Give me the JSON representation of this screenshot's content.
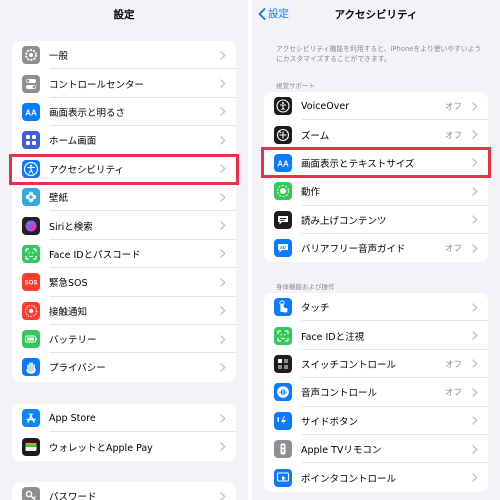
{
  "colors": {
    "highlight": "#e5314a",
    "link": "#0a7aff"
  },
  "left": {
    "title": "設定",
    "group1": [
      {
        "label": "一般",
        "icon": "gear-icon",
        "color": "#8e8e93"
      },
      {
        "label": "コントロールセンター",
        "icon": "toggles-icon",
        "color": "#8e8e93"
      },
      {
        "label": "画面表示と明るさ",
        "icon": "aa-icon",
        "color": "#0a7aff"
      },
      {
        "label": "ホーム画面",
        "icon": "home-grid-icon",
        "color": "#3f5fe0"
      },
      {
        "label": "アクセシビリティ",
        "icon": "accessibility-icon",
        "color": "#0a7aff"
      },
      {
        "label": "壁紙",
        "icon": "flower-icon",
        "color": "#34aadc"
      },
      {
        "label": "Siriと検索",
        "icon": "siri-icon",
        "color": "#222222"
      },
      {
        "label": "Face IDとパスコード",
        "icon": "face-id-icon",
        "color": "#34c759"
      },
      {
        "label": "緊急SOS",
        "icon": "sos-icon",
        "color": "#ff3b30"
      },
      {
        "label": "接触通知",
        "icon": "exposure-icon",
        "color": "#ff3b30"
      },
      {
        "label": "バッテリー",
        "icon": "battery-icon",
        "color": "#34c759"
      },
      {
        "label": "プライバシー",
        "icon": "hand-icon",
        "color": "#0a7aff"
      }
    ],
    "group2": [
      {
        "label": "App Store",
        "icon": "app-store-icon",
        "color": "#0a84ff"
      },
      {
        "label": "ウォレットとApple Pay",
        "icon": "wallet-icon",
        "color": "#1c1c1e"
      }
    ],
    "group3": [
      {
        "label": "パスワード",
        "icon": "key-icon",
        "color": "#8e8e93"
      }
    ]
  },
  "right": {
    "back_label": "設定",
    "title": "アクセシビリティ",
    "description": "アクセシビリティ機能を利用すると、iPhoneをより使いやすいようにカスタマイズすることができます。",
    "vision_header": "視覚サポート",
    "vision": [
      {
        "label": "VoiceOver",
        "value": "オフ",
        "icon": "voiceover-icon",
        "color": "#1c1c1e"
      },
      {
        "label": "ズーム",
        "value": "オフ",
        "icon": "zoom-icon",
        "color": "#1c1c1e"
      },
      {
        "label": "画面表示とテキストサイズ",
        "value": "",
        "icon": "aa-icon",
        "color": "#0a7aff"
      },
      {
        "label": "動作",
        "value": "",
        "icon": "motion-icon",
        "color": "#34c759"
      },
      {
        "label": "読み上げコンテンツ",
        "value": "",
        "icon": "speech-icon",
        "color": "#1c1c1e"
      },
      {
        "label": "バリアフリー音声ガイド",
        "value": "オフ",
        "icon": "audio-description-icon",
        "color": "#0a7aff"
      }
    ],
    "physical_header": "身体機能および操作",
    "physical": [
      {
        "label": "タッチ",
        "value": "",
        "icon": "touch-icon",
        "color": "#0a7aff"
      },
      {
        "label": "Face IDと注視",
        "value": "",
        "icon": "face-id-icon",
        "color": "#34c759"
      },
      {
        "label": "スイッチコントロール",
        "value": "オフ",
        "icon": "switch-control-icon",
        "color": "#1c1c1e"
      },
      {
        "label": "音声コントロール",
        "value": "オフ",
        "icon": "voice-control-icon",
        "color": "#0a7aff"
      },
      {
        "label": "サイドボタン",
        "value": "",
        "icon": "side-button-icon",
        "color": "#0a7aff"
      },
      {
        "label": "Apple TVリモコン",
        "value": "",
        "icon": "tv-remote-icon",
        "color": "#8e8e93"
      },
      {
        "label": "ポインタコントロール",
        "value": "",
        "icon": "pointer-icon",
        "color": "#0a7aff"
      }
    ]
  }
}
